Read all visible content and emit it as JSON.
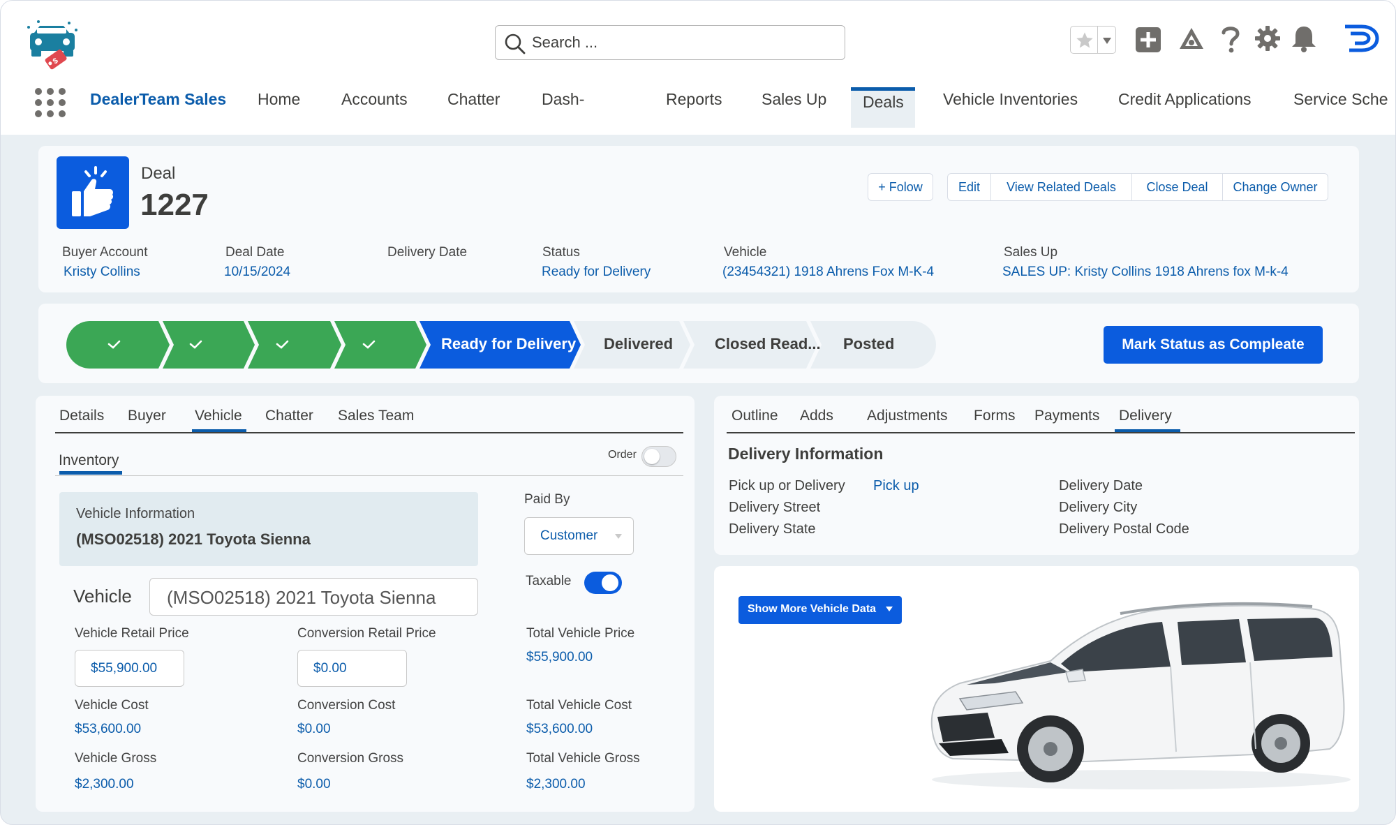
{
  "app": {
    "name": "DealerTeam Sales"
  },
  "search": {
    "placeholder": "Search ..."
  },
  "nav": {
    "items": [
      "Home",
      "Accounts",
      "Chatter",
      "Dash-",
      "Reports",
      "Sales Up",
      "Deals",
      "Vehicle Inventories",
      "Credit Applications",
      "Service Sche"
    ],
    "active": "Deals"
  },
  "record": {
    "type_label": "Deal",
    "number": "1227",
    "actions": {
      "follow": "+ Folow",
      "edit": "Edit",
      "view_related": "View Related Deals",
      "close_deal": "Close Deal",
      "change_owner": "Change Owner"
    },
    "fields": {
      "buyer_account": {
        "label": "Buyer Account",
        "value": "Kristy Collins"
      },
      "deal_date": {
        "label": "Deal Date",
        "value": "10/15/2024"
      },
      "delivery_date": {
        "label": "Delivery Date",
        "value": ""
      },
      "status": {
        "label": "Status",
        "value": "Ready for Delivery"
      },
      "vehicle": {
        "label": "Vehicle",
        "value": "(23454321) 1918 Ahrens Fox M-K-4"
      },
      "sales_up": {
        "label": "Sales Up",
        "value": "SALES UP: Kristy Collins 1918 Ahrens fox M-k-4"
      }
    }
  },
  "path": {
    "completed_steps": 4,
    "current": "Ready for Delivery",
    "upcoming": [
      "Delivered",
      "Closed Read...",
      "Posted"
    ],
    "mark_button": "Mark Status as Compleate"
  },
  "left_panel": {
    "tabs": [
      "Details",
      "Buyer",
      "Vehicle",
      "Chatter",
      "Sales Team"
    ],
    "active_tab": "Vehicle",
    "subtab": "Inventory",
    "order_toggle": {
      "label": "Order",
      "on": false
    },
    "vehicle_info": {
      "title": "Vehicle Information",
      "value": "(MSO02518) 2021 Toyota Sienna"
    },
    "paid_by": {
      "label": "Paid By",
      "value": "Customer"
    },
    "taxable": {
      "label": "Taxable",
      "on": true
    },
    "vehicle_field": {
      "label": "Vehicle",
      "value": "(MSO02518) 2021 Toyota Sienna"
    },
    "vehicle_retail_price": {
      "label": "Vehicle Retail Price",
      "value": "$55,900.00"
    },
    "conversion_retail_price": {
      "label": "Conversion Retail Price",
      "value": "$0.00"
    },
    "total_vehicle_price": {
      "label": "Total Vehicle Price",
      "value": "$55,900.00"
    },
    "vehicle_cost": {
      "label": "Vehicle Cost",
      "value": "$53,600.00"
    },
    "conversion_cost": {
      "label": "Conversion Cost",
      "value": "$0.00"
    },
    "total_vehicle_cost": {
      "label": "Total Vehicle Cost",
      "value": "$53,600.00"
    },
    "vehicle_gross": {
      "label": "Vehicle Gross",
      "value": "$2,300.00"
    },
    "conversion_gross": {
      "label": "Conversion Gross",
      "value": "$0.00"
    },
    "total_vehicle_gross": {
      "label": "Total Vehicle Gross",
      "value": "$2,300.00"
    }
  },
  "right_panel": {
    "tabs": [
      "Outline",
      "Adds",
      "Adjustments",
      "Forms",
      "Payments",
      "Delivery"
    ],
    "active_tab": "Delivery",
    "section_title": "Delivery Information",
    "pickup_or_delivery": {
      "label": "Pick up or Delivery",
      "value": "Pick up"
    },
    "delivery_street": {
      "label": "Delivery Street"
    },
    "delivery_state": {
      "label": "Delivery State"
    },
    "delivery_date": {
      "label": "Delivery Date"
    },
    "delivery_city": {
      "label": "Delivery City"
    },
    "delivery_postal_code": {
      "label": "Delivery Postal Code"
    },
    "show_more_button": "Show More Vehicle Data"
  },
  "colors": {
    "brand_blue": "#0b5cab",
    "button_blue": "#0b5cde",
    "path_green": "#3ba755",
    "path_current": "#0b5cde",
    "path_upcoming": "#e9eff3",
    "icon_teal": "#1a7fa0",
    "tag_red": "#e0484f"
  }
}
